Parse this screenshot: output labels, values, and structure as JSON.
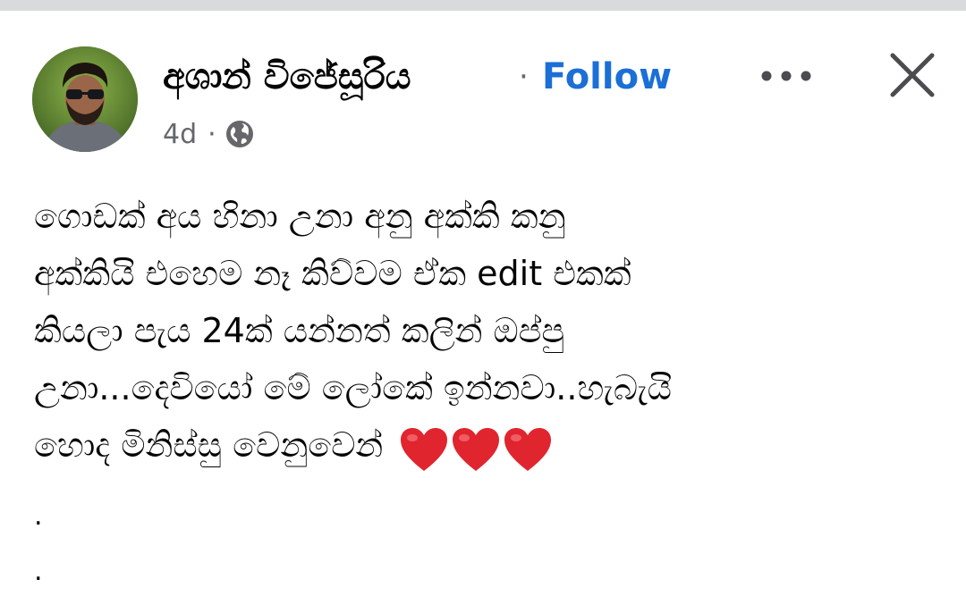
{
  "post": {
    "author_name": "අශාන් විජේසූරිය",
    "separator": "·",
    "follow_label": "Follow",
    "timestamp": "4d",
    "meta_separator": "·",
    "audience_icon": "globe-icon",
    "more_icon": "more-horizontal-icon",
    "close_icon": "close-icon",
    "text_lines": [
      "ගොඩක් අය හිනා උනා අනු අක්කි කනු",
      "අක්කියි එහෙම නෑ කිව්වම ඒක edit එකක්",
      "කියලා පැය 24ක් යන්නත් කලින් ඔප්පු",
      "උනා...දෙවියෝ මේ ලෝකේ ඉන්නවා..හැබැයි",
      "හොද මිනිස්සු වෙනුවෙන්"
    ],
    "reaction_emoji": "heart-icon",
    "trailing_dots": [
      ".",
      "."
    ]
  },
  "colors": {
    "follow": "#1b6fd6",
    "text": "#050505",
    "secondary": "#65676b",
    "heart": "#e0252f"
  }
}
